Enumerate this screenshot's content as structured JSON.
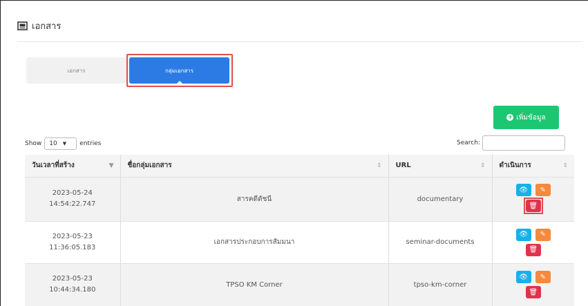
{
  "header": {
    "title": "เอกสาร",
    "icon": "document-icon"
  },
  "tabs": [
    {
      "label": "เอกสาร",
      "active": false
    },
    {
      "label": "กลุ่มเอกสาร",
      "active": true
    }
  ],
  "add_button": {
    "label": "เพิ่มข้อมูล",
    "icon": "plus-circle-icon",
    "color": "#1cc774"
  },
  "length": {
    "show": "Show",
    "value": "10",
    "entries": "entries"
  },
  "search": {
    "label": "Search:",
    "value": ""
  },
  "table": {
    "columns": [
      "วันเวลาที่สร้าง",
      "ชื่อกลุ่มเอกสาร",
      "URL",
      "ดำเนินการ"
    ],
    "rows": [
      {
        "date": "2023-05-24",
        "time": "14:54:22.747",
        "name": "สารคดีดัชนี",
        "url": "documentary"
      },
      {
        "date": "2023-05-23",
        "time": "11:36:05.183",
        "name": "เอกสารประกอบการสัมมนา",
        "url": "seminar-documents"
      },
      {
        "date": "2023-05-23",
        "time": "10:44:34.180",
        "name": "TPSO KM Corner",
        "url": "tpso-km-corner"
      }
    ]
  },
  "colors": {
    "primary": "#2c7be5",
    "view": "#19b0e8",
    "edit": "#f5893d",
    "delete": "#e0334b",
    "highlight": "#e04d4d"
  }
}
